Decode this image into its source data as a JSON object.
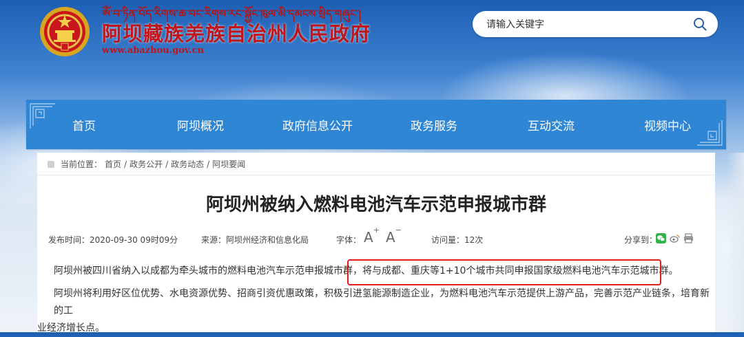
{
  "header": {
    "tibetan_name": "ༀ་བ་ཏིན་བོད་རིགས་ཆ་བང་རིགས་རང་སྐྱོང་ཁུལ་མི་དམངས་སྲིད་གཞུང་།",
    "site_name": "阿坝藏族羌族自治州人民政府",
    "site_url": "www.abazhou.gov.cn",
    "emblem_icon": "national-emblem-icon"
  },
  "search": {
    "placeholder": "请输入关键字",
    "icon": "search-icon"
  },
  "nav": {
    "items": [
      {
        "label": "首页"
      },
      {
        "label": "阿坝概况"
      },
      {
        "label": "政府信息公开"
      },
      {
        "label": "政务服务"
      },
      {
        "label": "互动交流"
      },
      {
        "label": "视频中心"
      }
    ]
  },
  "breadcrumb": {
    "prefix": "当前位置：",
    "items": [
      "首页",
      "政务公开",
      "政务动态",
      "阿坝要闻"
    ],
    "separator": "/"
  },
  "article": {
    "title": "阿坝州被纳入燃料电池汽车示范申报城市群",
    "publish_time_label": "发布时间：",
    "publish_time": "2020-09-30 09时09分",
    "source_label": "来源：",
    "source": "阿坝州经济和信息化局",
    "font_label": "字体：",
    "font_increase": "A",
    "font_increase_sup": "+",
    "font_decrease": "A",
    "font_decrease_sup": "−",
    "views_label": "访问量：",
    "views": "12次",
    "share_label": "分享到：",
    "share_icons": [
      "wechat-icon",
      "weibo-icon",
      "print-icon"
    ],
    "para1_a": "阿坝州被四川省纳入以成都为牵头城市的燃料电池汽车示范申报城市群，",
    "para1_b": "将与成都、重庆等1+10个城市共同申报国家级燃料电池汽车示范城市群。",
    "para2_a": "阿坝州将利用好区位优势、水电资源优势、招商引资优惠政策，积极引进氢能源制造企业，为燃料电池汽车示范提供上游产品，完善示范产业链条，培育新的工",
    "para2_b": "业经济增长点。"
  },
  "colors": {
    "brand_red": "#c0151b",
    "nav_blue": "#2f86d5",
    "highlight_red": "#e0201f"
  }
}
